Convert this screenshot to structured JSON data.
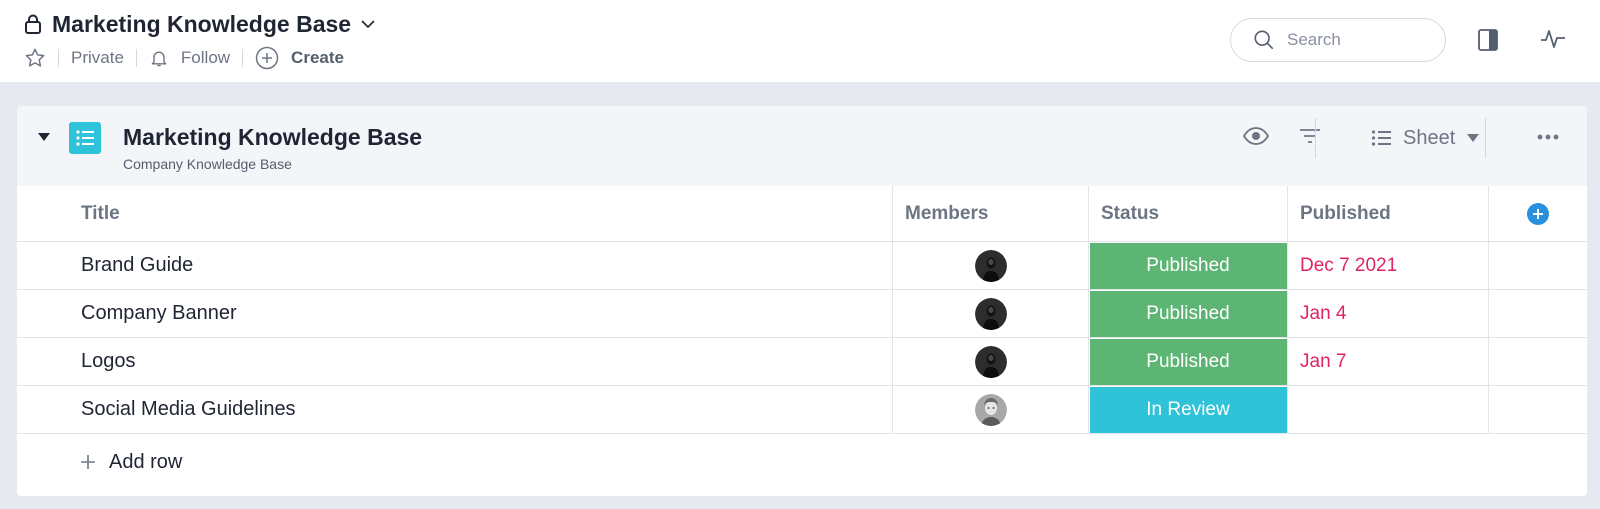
{
  "header": {
    "title": "Marketing Knowledge Base",
    "privacy_label": "Private",
    "follow_label": "Follow",
    "create_label": "Create",
    "search_placeholder": "Search"
  },
  "card": {
    "title": "Marketing Knowledge Base",
    "subtitle": "Company Knowledge Base",
    "view_label": "Sheet"
  },
  "table": {
    "columns": [
      "Title",
      "Members",
      "Status",
      "Published"
    ],
    "rows": [
      {
        "title": "Brand Guide",
        "status": "Published",
        "published": "Dec 7 2021",
        "status_color": "#5db573"
      },
      {
        "title": "Company Banner",
        "status": "Published",
        "published": "Jan 4",
        "status_color": "#5db573"
      },
      {
        "title": "Logos",
        "status": "Published",
        "published": "Jan 7",
        "status_color": "#5db573"
      },
      {
        "title": "Social Media Guidelines",
        "status": "In Review",
        "published": "",
        "status_color": "#2ec3d9"
      }
    ],
    "add_row_label": "Add row"
  },
  "icons": {
    "lock": "lock-icon",
    "chevron": "chevron-down-icon",
    "star": "star-icon",
    "bell": "bell-icon",
    "create": "plus-circle-icon",
    "search": "search-icon",
    "panel": "side-panel-icon",
    "activity": "activity-icon",
    "list": "list-icon",
    "eye": "eye-icon",
    "filter": "filter-icon",
    "more": "more-horizontal-icon"
  },
  "colors": {
    "accent": "#2a8fdd",
    "published": "#5db573",
    "in_review": "#2ec3d9",
    "date": "#e0245e",
    "list_badge": "#2ec3d9"
  }
}
